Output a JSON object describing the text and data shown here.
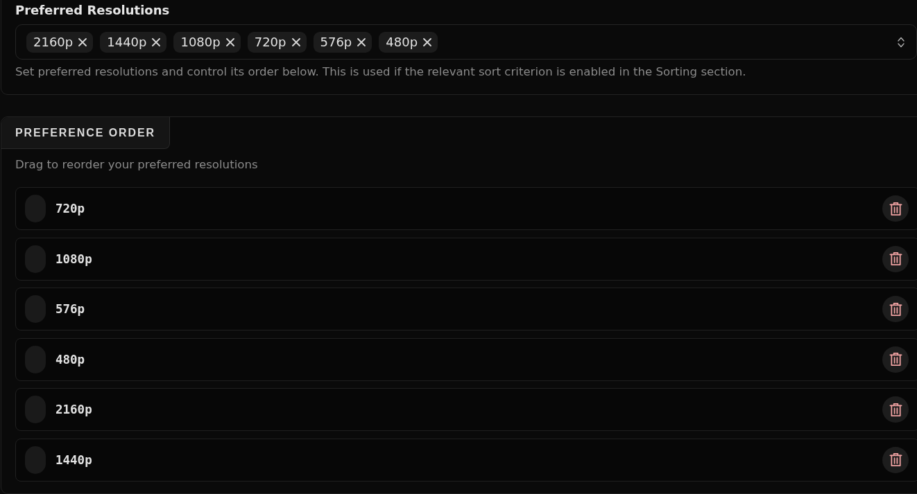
{
  "resolutions_field": {
    "label": "Preferred Resolutions",
    "chips": [
      {
        "label": "2160p"
      },
      {
        "label": "1440p"
      },
      {
        "label": "1080p"
      },
      {
        "label": "720p"
      },
      {
        "label": "576p"
      },
      {
        "label": "480p"
      }
    ],
    "help_text": "Set preferred resolutions and control its order below. This is used if the relevant sort criterion is enabled in the Sorting section."
  },
  "preference_order": {
    "tab": "PREFERENCE ORDER",
    "hint": "Drag to reorder your preferred resolutions",
    "items": [
      {
        "label": "720p"
      },
      {
        "label": "1080p"
      },
      {
        "label": "576p"
      },
      {
        "label": "480p"
      },
      {
        "label": "2160p"
      },
      {
        "label": "1440p"
      }
    ]
  }
}
